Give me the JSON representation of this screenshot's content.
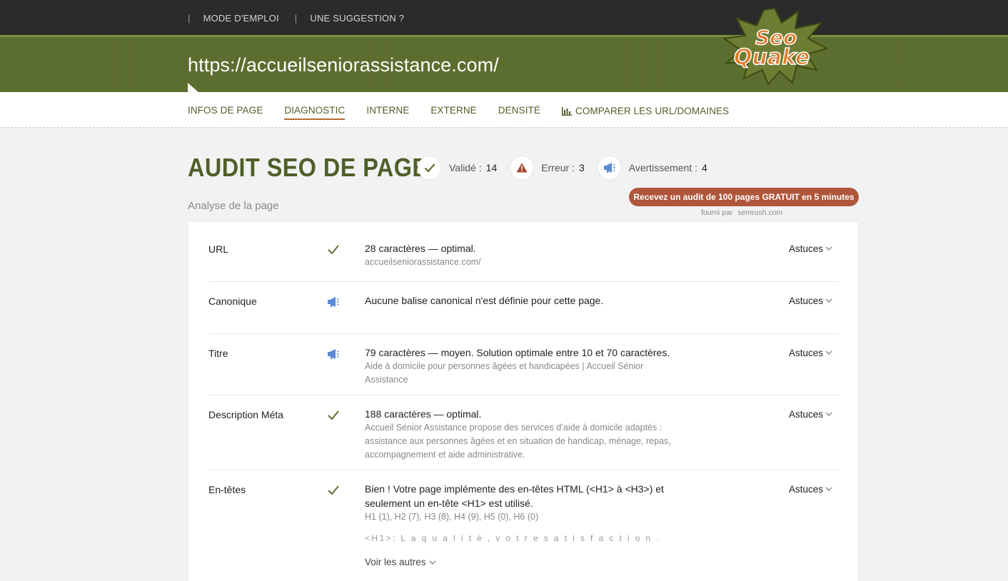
{
  "topnav": {
    "items": [
      {
        "sep": "|",
        "label": "MODE D'EMPLOI"
      },
      {
        "sep": "|",
        "label": "UNE SUGGESTION ?"
      }
    ]
  },
  "header": {
    "url": "https://accueilseniorassistance.com/",
    "logo_text_1": "Seo",
    "logo_text_2": "Quake"
  },
  "tabs": [
    {
      "label": "INFOS DE PAGE",
      "active": false
    },
    {
      "label": "DIAGNOSTIC",
      "active": true
    },
    {
      "label": "INTERNE",
      "active": false
    },
    {
      "label": "EXTERNE",
      "active": false
    },
    {
      "label": "DENSITÉ",
      "active": false
    },
    {
      "label": "COMPARER LES URL/DOMAINES",
      "active": false,
      "icon": "bar-chart-icon"
    }
  ],
  "audit": {
    "title": "AUDIT SEO DE PAGE",
    "subtitle": "Analyse de la page",
    "stats": {
      "valid_label": "Validé :",
      "valid_count": "14",
      "error_label": "Erreur :",
      "error_count": "3",
      "warning_label": "Avertissement :",
      "warning_count": "4"
    },
    "promo_button": "Recevez un audit de 100 pages GRATUIT en 5 minutes",
    "powered_by": "fourni par",
    "powered_site": "semrush.com"
  },
  "colors": {
    "brand_green": "#5e7030",
    "title_green": "#4f5f28",
    "promo": "#b0563a",
    "check": "#5e7030",
    "warning": "#5b8ad6",
    "error": "#a0452a"
  },
  "rows": [
    {
      "label": "URL",
      "status": "valid",
      "main": "28 caractères — optimal.",
      "sub": "accueilseniorassistance.com/",
      "tip": "Astuces"
    },
    {
      "label": "Canonique",
      "status": "warning",
      "main": "Aucune balise canonical n'est définie pour cette page.",
      "sub": "",
      "tip": "Astuces"
    },
    {
      "label": "Titre",
      "status": "warning",
      "main": "79 caractères — moyen. Solution optimale entre 10 et 70 caractères.",
      "sub": "Aide à domicile pour personnes âgées et handicapées | Accueil Sénior Assistance",
      "tip": "Astuces"
    },
    {
      "label": "Description Méta",
      "status": "valid",
      "main": "188 caractères — optimal.",
      "sub": "Accueil Sénior Assistance propose des services d’aide à domicile adaptés : assistance aux personnes âgées et en situation de handicap, ménage, repas, accompagnement et aide administrative.",
      "tip": "Astuces"
    },
    {
      "label": "En-têtes",
      "status": "valid",
      "main": "Bien ! Votre page implémente des en-têtes HTML (<H1> à <H3>) et seulement un en-tête <H1> est utilisé.",
      "sub": "H1 (1), H2 (7), H3 (8), H4 (9), H5 (0), H6 (0)",
      "h1_text": "<H1>: L a q u a l i t é , v o t r e s a t i s f a c t i o n .",
      "see_more": "Voir les autres",
      "tip": "Astuces"
    }
  ]
}
